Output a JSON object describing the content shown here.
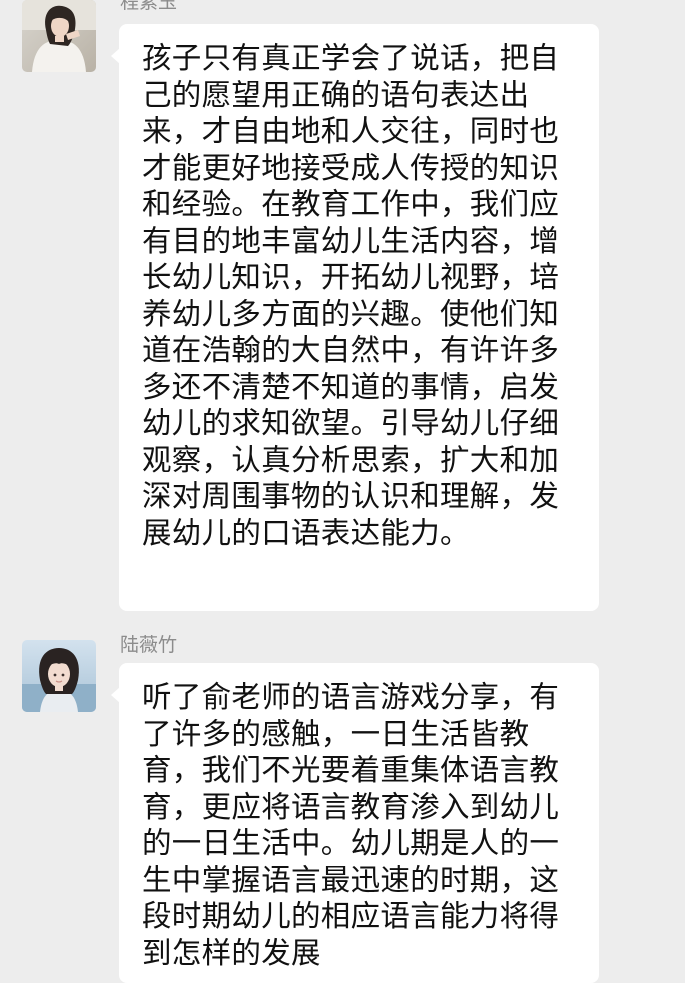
{
  "messages": [
    {
      "sender": "程紫玉",
      "avatar": "avatar-woman-white-shirt",
      "text": "孩子只有真正学会了说话，把自己的愿望用正确的语句表达出来，才自由地和人交往，同时也才能更好地接受成人传授的知识和经验。在教育工作中，我们应有目的地丰富幼儿生活内容，增长幼儿知识，开拓幼儿视野，培养幼儿多方面的兴趣。使他们知道在浩翰的大自然中，有许许多多还不清楚不知道的事情，启发幼儿的求知欲望。引导幼儿仔细观察，认真分析思索，扩大和加深对周围事物的认识和理解，发展幼儿的口语表达能力。"
    },
    {
      "sender": "陆薇竹",
      "avatar": "avatar-girl-bob-hair",
      "text": "听了俞老师的语言游戏分享，有了许多的感触，一日生活皆教育，我们不光要着重集体语言教育，更应将语言教育渗入到幼儿的一日生活中。幼儿期是人的一生中掌握语言最迅速的时期，这段时期幼儿的相应语言能力将得到怎样的发展"
    }
  ],
  "colors": {
    "background": "#ededed",
    "bubble": "#ffffff",
    "sender_name": "#8c8c8c",
    "message_text": "#111111"
  }
}
